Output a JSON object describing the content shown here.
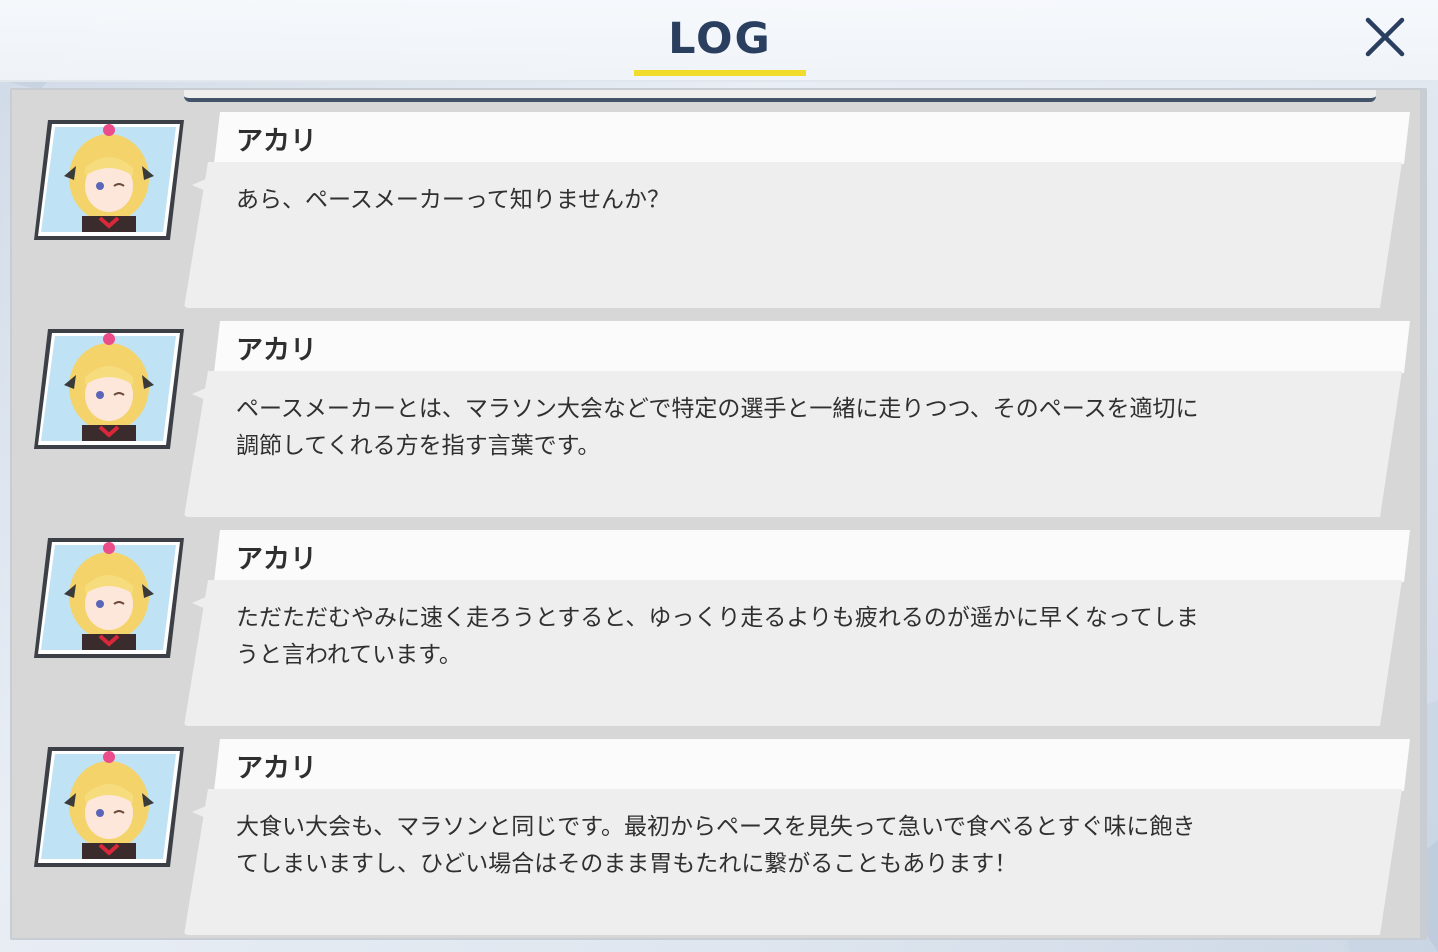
{
  "header": {
    "title": "LOG",
    "underline_color": "#f1dc2c",
    "close_icon": "close-x-icon"
  },
  "entries": [
    {
      "speaker": "アカリ",
      "avatar_icon": "character-portrait-akari",
      "text": "あら、ペースメーカーって知りませんか？"
    },
    {
      "speaker": "アカリ",
      "avatar_icon": "character-portrait-akari",
      "text": "ペースメーカーとは、マラソン大会などで特定の選手と一緒に走りつつ、そのペースを適切に\n調節してくれる方を指す言葉です。"
    },
    {
      "speaker": "アカリ",
      "avatar_icon": "character-portrait-akari",
      "text": "ただただむやみに速く走ろうとすると、ゆっくり走るよりも疲れるのが遥かに早くなってしま\nうと言われています。"
    },
    {
      "speaker": "アカリ",
      "avatar_icon": "character-portrait-akari",
      "text": "大食い大会も、マラソンと同じです。最初からペースを見失って急いで食べるとすぐ味に飽き\nてしまいますし、ひどい場合はそのまま胃もたれに繋がることもあります！"
    }
  ],
  "colors": {
    "title_text": "#2a3f5f",
    "name_text": "#2f2f2f",
    "message_text": "#303030",
    "panel_bg": "#d7d7d7",
    "card_bg": "#eeeeee"
  }
}
